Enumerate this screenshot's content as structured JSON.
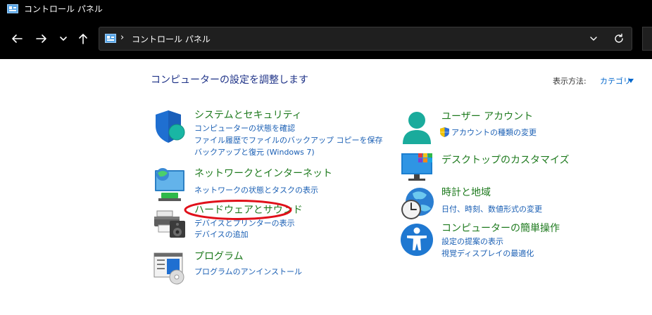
{
  "window": {
    "title": "コントロール パネル"
  },
  "address": {
    "separator": "›",
    "path": "コントロール パネル"
  },
  "page": {
    "title": "コンピューターの設定を調整します",
    "view_label": "表示方法:",
    "view_value": "カテゴリ"
  },
  "categories": {
    "system": {
      "title": "システムとセキュリティ",
      "links": [
        "コンピューターの状態を確認",
        "ファイル履歴でファイルのバックアップ コピーを保存",
        "バックアップと復元 (Windows 7)"
      ]
    },
    "network": {
      "title": "ネットワークとインターネット",
      "links": [
        "ネットワークの状態とタスクの表示"
      ]
    },
    "hardware": {
      "title": "ハードウェアとサウンド",
      "links": [
        "デバイスとプリンターの表示",
        "デバイスの追加"
      ]
    },
    "programs": {
      "title": "プログラム",
      "links": [
        "プログラムのアンインストール"
      ]
    },
    "user": {
      "title": "ユーザー アカウント",
      "links": [
        "アカウントの種類の変更"
      ]
    },
    "desktop": {
      "title": "デスクトップのカスタマイズ",
      "links": []
    },
    "clock": {
      "title": "時計と地域",
      "links": [
        "日付、時刻、数値形式の変更"
      ]
    },
    "access": {
      "title": "コンピューターの簡単操作",
      "links": [
        "設定の提案の表示",
        "視覚ディスプレイの最適化"
      ]
    }
  },
  "colors": {
    "heading_green": "#1e7a1e",
    "link_blue": "#1a5fb4",
    "title_blue": "#1e3287",
    "highlight_red": "#e0101a",
    "titlebar_bg": "#000000"
  },
  "icons": [
    "control-panel-icon",
    "back-arrow-icon",
    "forward-arrow-icon",
    "chevron-down-icon",
    "up-arrow-icon",
    "refresh-icon",
    "shield-icon",
    "network-icon",
    "printer-icon",
    "program-icon",
    "user-icon",
    "desktop-icon",
    "clock-globe-icon",
    "accessibility-icon",
    "uac-shield-icon"
  ]
}
